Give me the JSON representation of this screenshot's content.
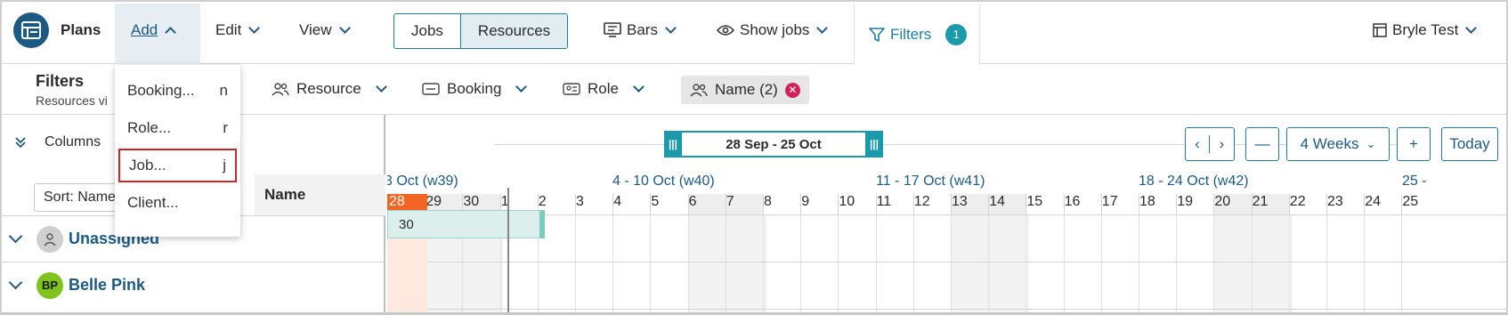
{
  "topbar": {
    "app_title": "Plans",
    "add_label": "Add",
    "edit_label": "Edit",
    "view_label": "View",
    "toggle": {
      "jobs": "Jobs",
      "resources": "Resources",
      "active": "Resources"
    },
    "bars_label": "Bars",
    "show_jobs_label": "Show jobs",
    "filters_label": "Filters",
    "filters_count": "1",
    "workspace_label": "Bryle Test"
  },
  "filterbar": {
    "title": "Filters",
    "subtitle": "Resources vi",
    "items": [
      "Resource",
      "Booking",
      "Role"
    ],
    "chip_label": "Name (2)"
  },
  "add_menu": {
    "items": [
      {
        "label": "Booking...",
        "shortcut": "n"
      },
      {
        "label": "Role...",
        "shortcut": "r"
      },
      {
        "label": "Job...",
        "shortcut": "j",
        "highlighted": true
      },
      {
        "label": "Client...",
        "shortcut": ""
      }
    ]
  },
  "leftpane": {
    "columns_label": "Columns",
    "sort_label": "Sort: Name",
    "name_header": "Name",
    "rows": [
      {
        "name": "Unassigned",
        "avatar": "",
        "avatar_color": "#cfcfcf"
      },
      {
        "name": "Belle Pink",
        "avatar": "BP",
        "avatar_color": "#7fc31c"
      }
    ]
  },
  "timeline": {
    "range_label": "28 Sep - 25 Oct",
    "duration_label": "4 Weeks",
    "today_label": "Today",
    "weeks": [
      "3 Oct (w39)",
      "4 - 10 Oct (w40)",
      "11 - 17 Oct (w41)",
      "18 - 24 Oct (w42)",
      "25 -"
    ],
    "days": [
      "28",
      "29",
      "30",
      "1",
      "2",
      "3",
      "4",
      "5",
      "6",
      "7",
      "8",
      "9",
      "10",
      "11",
      "12",
      "13",
      "14",
      "15",
      "16",
      "17",
      "18",
      "19",
      "20",
      "21",
      "22",
      "23",
      "24",
      "25"
    ],
    "booking_label": "30"
  },
  "colors": {
    "accent": "#1c5a84",
    "teal": "#1a9aaa",
    "today": "#f26522",
    "chip_close": "#d0215a"
  }
}
